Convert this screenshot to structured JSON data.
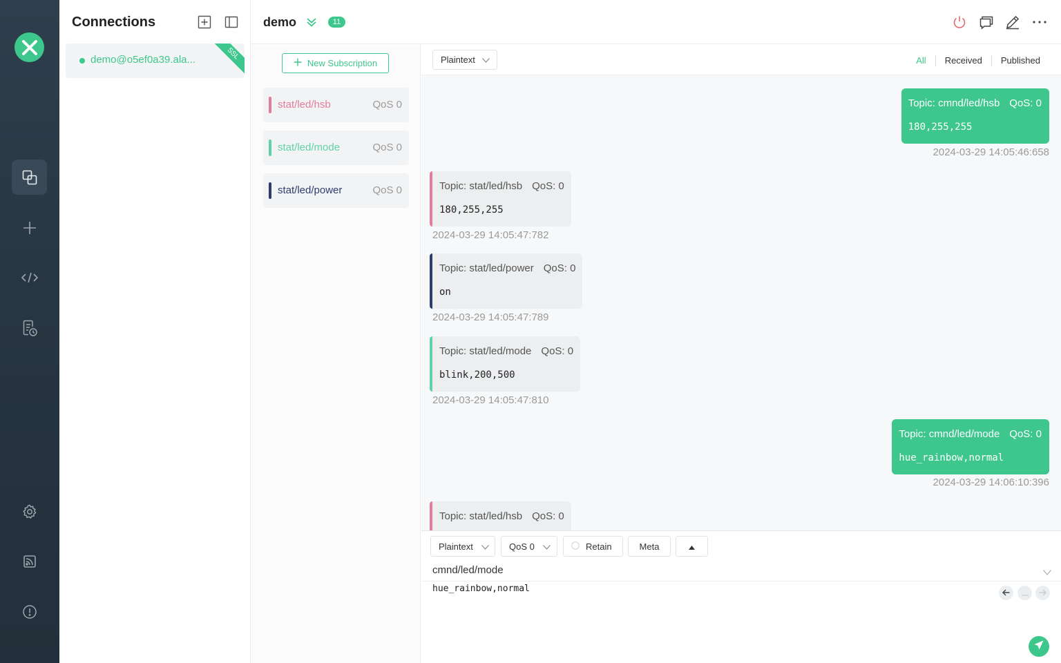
{
  "connections": {
    "title": "Connections",
    "items": [
      {
        "name": "demo@o5ef0a39.ala...",
        "ssl": "SSL"
      }
    ]
  },
  "header": {
    "name": "demo",
    "badge": "11"
  },
  "subscriptions": {
    "new_label": "New Subscription",
    "items": [
      {
        "topic": "stat/led/hsb",
        "qos": "QoS 0",
        "color": "#e27d9c"
      },
      {
        "topic": "stat/led/mode",
        "qos": "QoS 0",
        "color": "#5fd3a6"
      },
      {
        "topic": "stat/led/power",
        "qos": "QoS 0",
        "color": "#2c3e6e"
      }
    ]
  },
  "messages": {
    "format": "Plaintext",
    "filters": [
      "All",
      "Received",
      "Published"
    ],
    "list": [
      {
        "dir": "out",
        "topic": "Topic: cmnd/led/hsb",
        "qos": "QoS: 0",
        "payload": "180,255,255",
        "time": "2024-03-29 14:05:46:658"
      },
      {
        "dir": "in",
        "topic": "Topic: stat/led/hsb",
        "qos": "QoS: 0",
        "payload": "180,255,255",
        "time": "2024-03-29 14:05:47:782",
        "color": "#e27d9c"
      },
      {
        "dir": "in",
        "topic": "Topic: stat/led/power",
        "qos": "QoS: 0",
        "payload": "on",
        "time": "2024-03-29 14:05:47:789",
        "color": "#2c3e6e"
      },
      {
        "dir": "in",
        "topic": "Topic: stat/led/mode",
        "qos": "QoS: 0",
        "payload": "blink,200,500",
        "time": "2024-03-29 14:05:47:810",
        "color": "#5fd3a6"
      },
      {
        "dir": "out",
        "topic": "Topic: cmnd/led/mode",
        "qos": "QoS: 0",
        "payload": "hue_rainbow,normal",
        "time": "2024-03-29 14:06:10:396"
      },
      {
        "dir": "in",
        "topic": "Topic: stat/led/hsb",
        "qos": "QoS: 0",
        "color": "#e27d9c"
      }
    ]
  },
  "publish": {
    "format": "Plaintext",
    "qos": "QoS 0",
    "retain": "Retain",
    "meta": "Meta",
    "topic": "cmnd/led/mode",
    "payload": "hue_rainbow,normal"
  },
  "colors": {
    "accent": "#3dc78c",
    "rail": "#2b3a47"
  }
}
